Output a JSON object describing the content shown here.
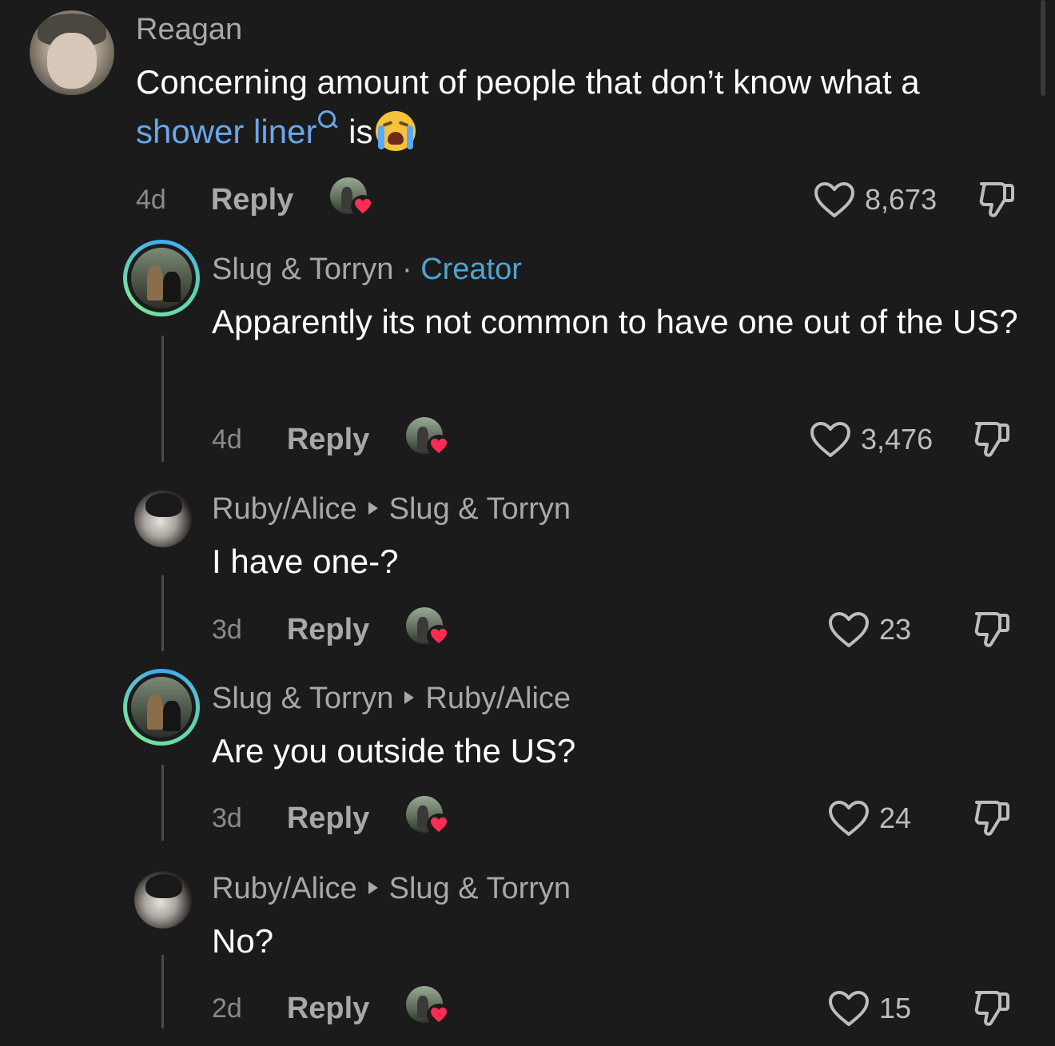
{
  "comments": [
    {
      "author": "Reagan",
      "text_before_link": "Concerning amount of people that don’t know what a ",
      "link_text": "shower liner",
      "text_after_link": " is",
      "emoji": "loudly-crying-face",
      "time": "4d",
      "reply_label": "Reply",
      "likes": "8,673"
    },
    {
      "author": "Slug & Torryn",
      "separator": "·",
      "badge": "Creator",
      "text": "Apparently its not common to have one out of the US?",
      "time": "4d",
      "reply_label": "Reply",
      "likes": "3,476"
    },
    {
      "author": "Ruby/Alice",
      "reply_to": "Slug & Torryn",
      "text": "I have one-?",
      "time": "3d",
      "reply_label": "Reply",
      "likes": "23"
    },
    {
      "author": "Slug & Torryn",
      "reply_to": "Ruby/Alice",
      "text": "Are you outside the US?",
      "time": "3d",
      "reply_label": "Reply",
      "likes": "24"
    },
    {
      "author": "Ruby/Alice",
      "reply_to": "Slug & Torryn",
      "text": "No?",
      "time": "2d",
      "reply_label": "Reply",
      "likes": "15"
    }
  ],
  "colors": {
    "background": "#1b1b1b",
    "creator_badge": "#4fa3d1",
    "link": "#6aa6e8",
    "liker_heart": "#fe2c55"
  },
  "icons": {
    "like": "heart-outline-icon",
    "dislike": "thumbs-down-icon",
    "link_search": "search-icon",
    "liked_by_creator": "heart-icon"
  }
}
